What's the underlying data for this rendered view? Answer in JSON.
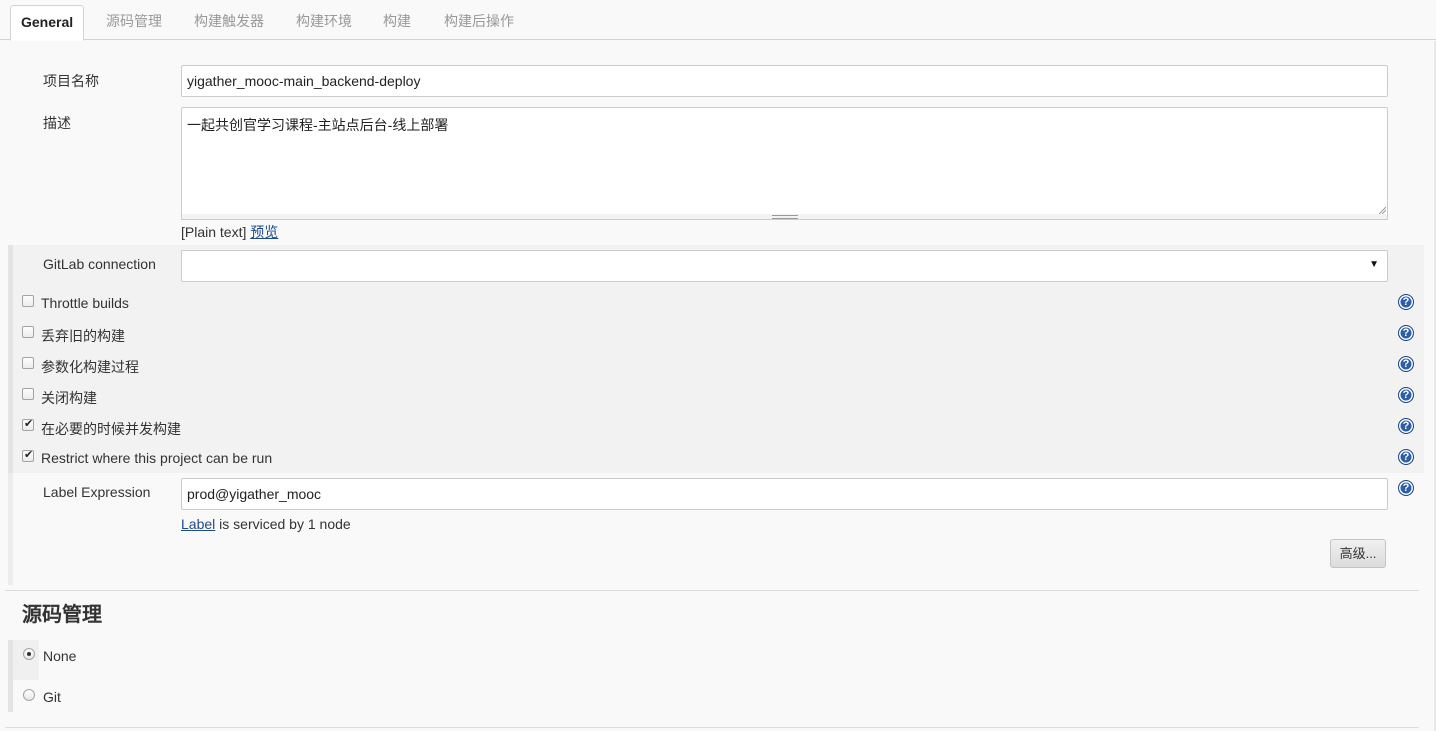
{
  "tabs": [
    {
      "label": "General",
      "active": true
    },
    {
      "label": "源码管理"
    },
    {
      "label": "构建触发器"
    },
    {
      "label": "构建环境"
    },
    {
      "label": "构建"
    },
    {
      "label": "构建后操作"
    }
  ],
  "general": {
    "project_name_label": "项目名称",
    "project_name_value": "yigather_mooc-main_backend-deploy",
    "description_label": "描述",
    "description_value": "一起共创官学习课程-主站点后台-线上部署",
    "description_format": "[Plain text]",
    "preview_link": "预览",
    "gitlab_connection_label": "GitLab connection",
    "gitlab_connection_value": "",
    "options": [
      {
        "label": "Throttle builds",
        "checked": false
      },
      {
        "label": "丢弃旧的构建",
        "checked": false
      },
      {
        "label": "参数化构建过程",
        "checked": false
      },
      {
        "label": "关闭构建",
        "checked": false
      },
      {
        "label": "在必要的时候并发构建",
        "checked": true
      },
      {
        "label": "Restrict where this project can be run",
        "checked": true
      }
    ],
    "label_expression_label": "Label Expression",
    "label_expression_value": "prod@yigather_mooc",
    "label_link": "Label",
    "label_status": " is serviced by 1 node",
    "advanced_button": "高级..."
  },
  "scm": {
    "title": "源码管理",
    "options": [
      {
        "label": "None",
        "selected": true
      },
      {
        "label": "Git",
        "selected": false
      }
    ]
  },
  "help_icon": "?",
  "dropdown_icon": "▼"
}
